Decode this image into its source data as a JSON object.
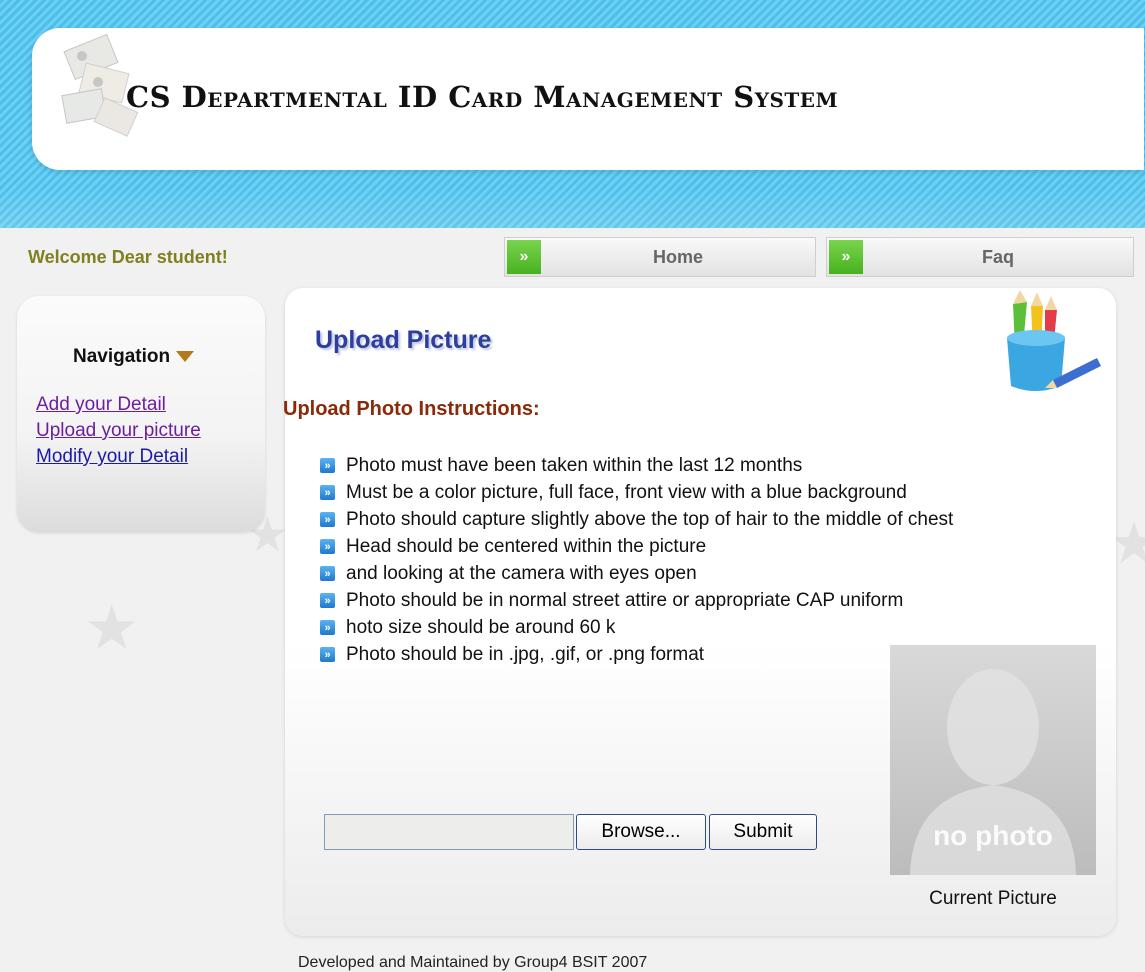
{
  "header": {
    "title": "CS Departmental ID Card Management System",
    "logo_icon": "id-cards-logo-icon"
  },
  "welcome": "Welcome Dear student!",
  "topnav": [
    {
      "label": "Home",
      "icon": "double-chevron-right-icon"
    },
    {
      "label": "Faq",
      "icon": "double-chevron-right-icon"
    }
  ],
  "sidebar": {
    "heading": "Navigation",
    "links": [
      {
        "label": "Add your Detail"
      },
      {
        "label": "Upload your picture"
      },
      {
        "label": "Modify your Detail"
      }
    ]
  },
  "main": {
    "page_title": "Upload Picture",
    "instructions_heading": "Upload Photo Instructions:",
    "instructions": [
      "Photo must have been taken within the last 12 months",
      "Must be a color picture, full face, front view with a blue background",
      "Photo should capture slightly above the top of hair to the middle of chest",
      "Head should be centered within the picture",
      "and looking at the camera with eyes open",
      "Photo should be in normal street attire or appropriate CAP uniform",
      "hoto size should be around 60 k",
      "Photo should be in .jpg, .gif, or .png format"
    ],
    "file_input_value": "",
    "browse_label": "Browse...",
    "submit_label": "Submit",
    "photo_placeholder_text": "no photo",
    "photo_caption": "Current Picture"
  },
  "footer": "Developed and Maintained by Group4 BSIT 2007",
  "colors": {
    "header_blue": "#4cc0ec",
    "title_blue": "#2d3f9a",
    "instructions_heading": "#8b2a08",
    "welcome_text": "#808020",
    "nav_green": "#48b21e",
    "link_blue": "#1a1aa8",
    "link_visited": "#6b1fa0"
  }
}
